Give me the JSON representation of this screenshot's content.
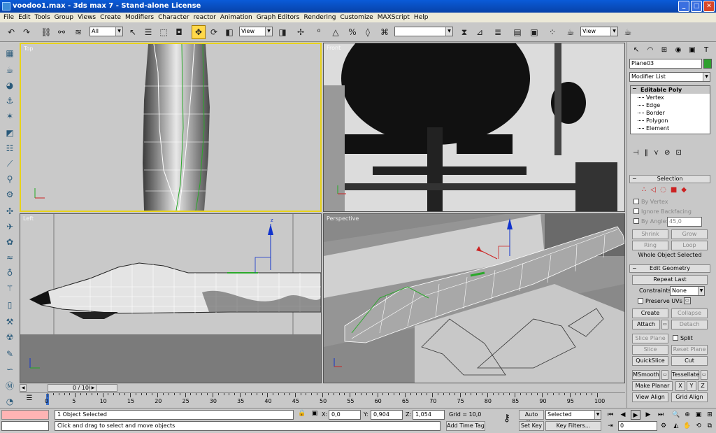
{
  "title": "voodoo1.max - 3ds max 7   - Stand-alone License",
  "menu": [
    "File",
    "Edit",
    "Tools",
    "Group",
    "Views",
    "Create",
    "Modifiers",
    "Character",
    "reactor",
    "Animation",
    "Graph Editors",
    "Rendering",
    "Customize",
    "MAXScript",
    "Help"
  ],
  "toolbar": {
    "selection_filter": "All",
    "ref_coord": "View",
    "named_sel": "",
    "render_view": "View"
  },
  "viewports": {
    "top_label": "Top",
    "front_label": "Front",
    "left_label": "Left",
    "persp_label": "Perspective"
  },
  "command_panel": {
    "object_name": "Plane03",
    "object_color": "#2fa02f",
    "modifier_list": "Modifier List",
    "stack_top": "Editable Poly",
    "sub_objects": [
      "Vertex",
      "Edge",
      "Border",
      "Polygon",
      "Element"
    ],
    "selection": {
      "title": "Selection",
      "by_vertex": "By Vertex",
      "ignore_backfacing": "Ignore Backfacing",
      "by_angle": "By Angle:",
      "angle_value": "45,0",
      "shrink": "Shrink",
      "grow": "Grow",
      "ring": "Ring",
      "loop": "Loop",
      "status": "Whole Object Selected"
    },
    "edit_geometry": {
      "title": "Edit Geometry",
      "repeat_last": "Repeat Last",
      "constraints_label": "Constraints:",
      "constraints_value": "None",
      "preserve_uvs": "Preserve UVs",
      "create": "Create",
      "collapse": "Collapse",
      "attach": "Attach",
      "detach": "Detach",
      "slice_plane": "Slice Plane",
      "split": "Split",
      "slice": "Slice",
      "reset_plane": "Reset Plane",
      "quickslice": "QuickSlice",
      "cut": "Cut",
      "msmooth": "MSmooth",
      "tessellate": "Tessellate",
      "make_planar": "Make Planar",
      "x": "X",
      "y": "Y",
      "z": "Z",
      "view_align": "View Align",
      "grid_align": "Grid Align"
    }
  },
  "timeline": {
    "frame_label": "0 / 100",
    "ticks": [
      "0",
      "5",
      "10",
      "15",
      "20",
      "25",
      "30",
      "35",
      "40",
      "45",
      "50",
      "55",
      "60",
      "65",
      "70",
      "75",
      "80",
      "85",
      "90",
      "95",
      "100"
    ]
  },
  "status": {
    "selected": "1 Object Selected",
    "prompt": "Click and drag to select and move objects",
    "x_label": "X:",
    "x_value": "0,0",
    "y_label": "Y:",
    "y_value": "0,904",
    "z_label": "Z:",
    "z_value": "1,054",
    "grid": "Grid = 10,0",
    "add_time_tag": "Add Time Tag",
    "auto_key": "Auto Key",
    "set_key": "Set Key",
    "selected_dd": "Selected",
    "key_filters": "Key Filters...",
    "frame": "0"
  }
}
